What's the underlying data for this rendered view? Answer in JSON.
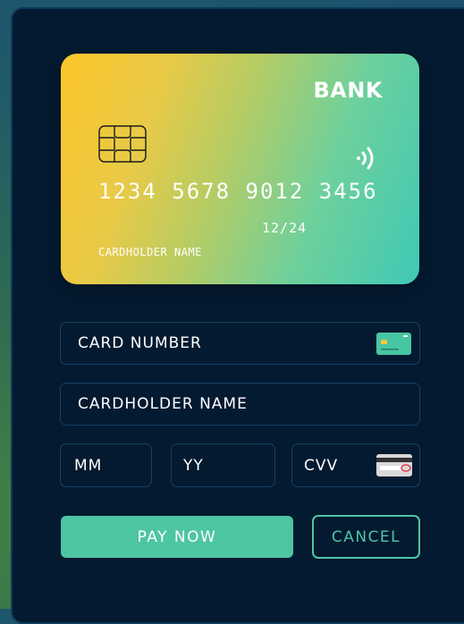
{
  "card": {
    "bank": "BANK",
    "number": "1234 5678 9012 3456",
    "expiry": "12/24",
    "holder": "CARDHOLDER NAME",
    "chip_icon": "chip-icon",
    "contactless_icon": "contactless-icon",
    "gradient_colors": [
      "#fcc52a",
      "#3fc9b6"
    ]
  },
  "form": {
    "card_number_placeholder": "CARD NUMBER",
    "cardholder_name_placeholder": "CARDHOLDER NAME",
    "month_placeholder": "MM",
    "year_placeholder": "YY",
    "cvv_placeholder": "CVV",
    "card_type_icon": "credit-card-icon",
    "cvv_icon": "card-back-icon"
  },
  "actions": {
    "pay_label": "PAY NOW",
    "cancel_label": "CANCEL"
  },
  "colors": {
    "panel_bg": "#041a30",
    "field_border": "#173e63",
    "accent": "#4ec5a3"
  }
}
